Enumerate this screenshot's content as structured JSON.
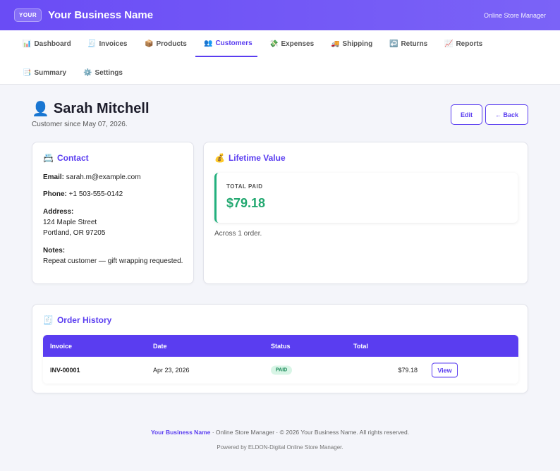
{
  "header": {
    "badge": "YOUR",
    "brand": "Your Business Name",
    "subtitle": "Online Store Manager"
  },
  "nav": {
    "items": [
      {
        "icon": "📊",
        "label": "Dashboard"
      },
      {
        "icon": "🧾",
        "label": "Invoices"
      },
      {
        "icon": "📦",
        "label": "Products"
      },
      {
        "icon": "👥",
        "label": "Customers",
        "active": true
      },
      {
        "icon": "💸",
        "label": "Expenses"
      },
      {
        "icon": "🚚",
        "label": "Shipping"
      },
      {
        "icon": "↩️",
        "label": "Returns"
      },
      {
        "icon": "📈",
        "label": "Reports"
      },
      {
        "icon": "📑",
        "label": "Summary"
      },
      {
        "icon": "⚙️",
        "label": "Settings"
      }
    ]
  },
  "customer": {
    "icon": "👤",
    "name": "Sarah Mitchell",
    "since": "Customer since May 07, 2026.",
    "edit_label": "Edit",
    "back_label": "← Back"
  },
  "contact": {
    "icon": "📇",
    "title": "Contact",
    "email_label": "Email:",
    "email": "sarah.m@example.com",
    "phone_label": "Phone:",
    "phone": "+1 503-555-0142",
    "address_label": "Address:",
    "address_line1": "124 Maple Street",
    "address_line2": "Portland, OR 97205",
    "notes_label": "Notes:",
    "notes": "Repeat customer — gift wrapping requested."
  },
  "lifetime": {
    "icon": "💰",
    "title": "Lifetime Value",
    "total_label": "TOTAL PAID",
    "total_value": "$79.18",
    "note": "Across 1 order."
  },
  "orders": {
    "icon": "🧾",
    "title": "Order History",
    "columns": [
      "Invoice",
      "Date",
      "Status",
      "Total"
    ],
    "rows": [
      {
        "invoice": "INV-00001",
        "date": "Apr 23, 2026",
        "status": "PAID",
        "total": "$79.18",
        "action": "View"
      }
    ]
  },
  "footer": {
    "brand": "Your Business Name",
    "text": " · Online Store Manager · © 2026 Your Business Name. All rights reserved.",
    "powered": "Powered by ELDON-Digital Online Store Manager."
  },
  "colors": {
    "accent": "#5a3df0",
    "success": "#22a870",
    "background": "#f4f5fa"
  }
}
